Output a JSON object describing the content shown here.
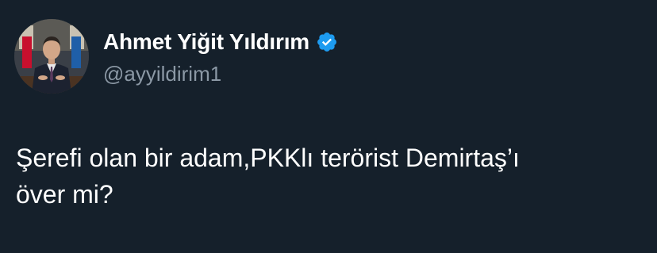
{
  "author": {
    "display_name": "Ahmet Yiğit Yıldırım",
    "handle": "@ayyildirim1",
    "verified": true,
    "verified_badge_color": "#1d9bf0",
    "avatar_icon": "profile-photo"
  },
  "tweet": {
    "text": "Şerefi olan bir adam,PKKlı terörist Demirtaş’ı\növer mi?"
  },
  "colors": {
    "background": "#15202b",
    "primary_text": "#ffffff",
    "secondary_text": "#8b98a5"
  }
}
